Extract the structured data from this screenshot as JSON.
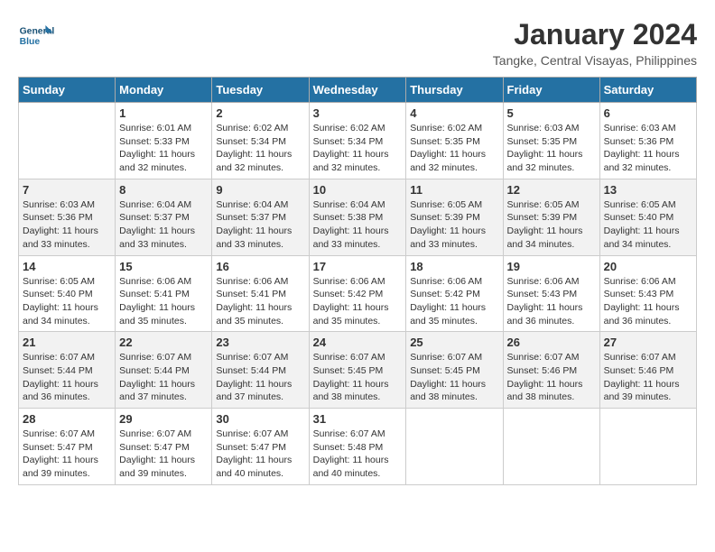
{
  "header": {
    "logo_line1": "General",
    "logo_line2": "Blue",
    "month_year": "January 2024",
    "location": "Tangke, Central Visayas, Philippines"
  },
  "weekdays": [
    "Sunday",
    "Monday",
    "Tuesday",
    "Wednesday",
    "Thursday",
    "Friday",
    "Saturday"
  ],
  "weeks": [
    [
      {
        "day": "",
        "sunrise": "",
        "sunset": "",
        "daylight": ""
      },
      {
        "day": "1",
        "sunrise": "6:01 AM",
        "sunset": "5:33 PM",
        "daylight": "11 hours and 32 minutes."
      },
      {
        "day": "2",
        "sunrise": "6:02 AM",
        "sunset": "5:34 PM",
        "daylight": "11 hours and 32 minutes."
      },
      {
        "day": "3",
        "sunrise": "6:02 AM",
        "sunset": "5:34 PM",
        "daylight": "11 hours and 32 minutes."
      },
      {
        "day": "4",
        "sunrise": "6:02 AM",
        "sunset": "5:35 PM",
        "daylight": "11 hours and 32 minutes."
      },
      {
        "day": "5",
        "sunrise": "6:03 AM",
        "sunset": "5:35 PM",
        "daylight": "11 hours and 32 minutes."
      },
      {
        "day": "6",
        "sunrise": "6:03 AM",
        "sunset": "5:36 PM",
        "daylight": "11 hours and 32 minutes."
      }
    ],
    [
      {
        "day": "7",
        "sunrise": "6:03 AM",
        "sunset": "5:36 PM",
        "daylight": "11 hours and 33 minutes."
      },
      {
        "day": "8",
        "sunrise": "6:04 AM",
        "sunset": "5:37 PM",
        "daylight": "11 hours and 33 minutes."
      },
      {
        "day": "9",
        "sunrise": "6:04 AM",
        "sunset": "5:37 PM",
        "daylight": "11 hours and 33 minutes."
      },
      {
        "day": "10",
        "sunrise": "6:04 AM",
        "sunset": "5:38 PM",
        "daylight": "11 hours and 33 minutes."
      },
      {
        "day": "11",
        "sunrise": "6:05 AM",
        "sunset": "5:39 PM",
        "daylight": "11 hours and 33 minutes."
      },
      {
        "day": "12",
        "sunrise": "6:05 AM",
        "sunset": "5:39 PM",
        "daylight": "11 hours and 34 minutes."
      },
      {
        "day": "13",
        "sunrise": "6:05 AM",
        "sunset": "5:40 PM",
        "daylight": "11 hours and 34 minutes."
      }
    ],
    [
      {
        "day": "14",
        "sunrise": "6:05 AM",
        "sunset": "5:40 PM",
        "daylight": "11 hours and 34 minutes."
      },
      {
        "day": "15",
        "sunrise": "6:06 AM",
        "sunset": "5:41 PM",
        "daylight": "11 hours and 35 minutes."
      },
      {
        "day": "16",
        "sunrise": "6:06 AM",
        "sunset": "5:41 PM",
        "daylight": "11 hours and 35 minutes."
      },
      {
        "day": "17",
        "sunrise": "6:06 AM",
        "sunset": "5:42 PM",
        "daylight": "11 hours and 35 minutes."
      },
      {
        "day": "18",
        "sunrise": "6:06 AM",
        "sunset": "5:42 PM",
        "daylight": "11 hours and 35 minutes."
      },
      {
        "day": "19",
        "sunrise": "6:06 AM",
        "sunset": "5:43 PM",
        "daylight": "11 hours and 36 minutes."
      },
      {
        "day": "20",
        "sunrise": "6:06 AM",
        "sunset": "5:43 PM",
        "daylight": "11 hours and 36 minutes."
      }
    ],
    [
      {
        "day": "21",
        "sunrise": "6:07 AM",
        "sunset": "5:44 PM",
        "daylight": "11 hours and 36 minutes."
      },
      {
        "day": "22",
        "sunrise": "6:07 AM",
        "sunset": "5:44 PM",
        "daylight": "11 hours and 37 minutes."
      },
      {
        "day": "23",
        "sunrise": "6:07 AM",
        "sunset": "5:44 PM",
        "daylight": "11 hours and 37 minutes."
      },
      {
        "day": "24",
        "sunrise": "6:07 AM",
        "sunset": "5:45 PM",
        "daylight": "11 hours and 38 minutes."
      },
      {
        "day": "25",
        "sunrise": "6:07 AM",
        "sunset": "5:45 PM",
        "daylight": "11 hours and 38 minutes."
      },
      {
        "day": "26",
        "sunrise": "6:07 AM",
        "sunset": "5:46 PM",
        "daylight": "11 hours and 38 minutes."
      },
      {
        "day": "27",
        "sunrise": "6:07 AM",
        "sunset": "5:46 PM",
        "daylight": "11 hours and 39 minutes."
      }
    ],
    [
      {
        "day": "28",
        "sunrise": "6:07 AM",
        "sunset": "5:47 PM",
        "daylight": "11 hours and 39 minutes."
      },
      {
        "day": "29",
        "sunrise": "6:07 AM",
        "sunset": "5:47 PM",
        "daylight": "11 hours and 39 minutes."
      },
      {
        "day": "30",
        "sunrise": "6:07 AM",
        "sunset": "5:47 PM",
        "daylight": "11 hours and 40 minutes."
      },
      {
        "day": "31",
        "sunrise": "6:07 AM",
        "sunset": "5:48 PM",
        "daylight": "11 hours and 40 minutes."
      },
      {
        "day": "",
        "sunrise": "",
        "sunset": "",
        "daylight": ""
      },
      {
        "day": "",
        "sunrise": "",
        "sunset": "",
        "daylight": ""
      },
      {
        "day": "",
        "sunrise": "",
        "sunset": "",
        "daylight": ""
      }
    ]
  ]
}
